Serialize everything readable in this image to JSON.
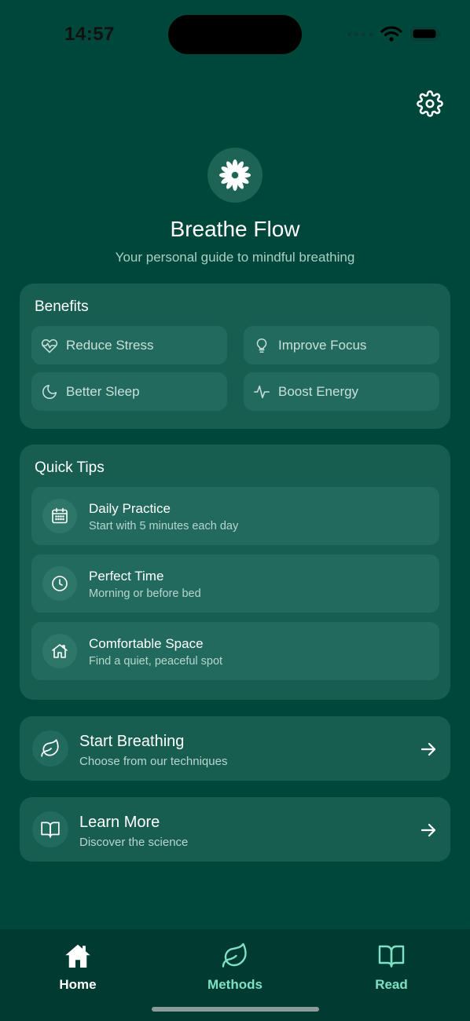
{
  "status_bar": {
    "time": "14:57"
  },
  "header": {
    "settings_icon": "gear-icon",
    "logo_icon": "sparkle-flower-icon",
    "title": "Breathe Flow",
    "subtitle": "Your personal guide to mindful breathing"
  },
  "benefits": {
    "title": "Benefits",
    "items": [
      {
        "label": "Reduce Stress",
        "icon": "heart-pulse-icon"
      },
      {
        "label": "Improve Focus",
        "icon": "lightbulb-icon"
      },
      {
        "label": "Better Sleep",
        "icon": "moon-icon"
      },
      {
        "label": "Boost Energy",
        "icon": "activity-icon"
      }
    ]
  },
  "tips": {
    "title": "Quick Tips",
    "items": [
      {
        "title": "Daily Practice",
        "subtitle": "Start with 5 minutes each day",
        "icon": "calendar-icon"
      },
      {
        "title": "Perfect Time",
        "subtitle": "Morning or before bed",
        "icon": "clock-icon"
      },
      {
        "title": "Comfortable Space",
        "subtitle": "Find a quiet, peaceful spot",
        "icon": "home-icon"
      }
    ]
  },
  "actions": [
    {
      "title": "Start Breathing",
      "subtitle": "Choose from our techniques",
      "icon": "leaf-icon"
    },
    {
      "title": "Learn More",
      "subtitle": "Discover the science",
      "icon": "book-icon"
    }
  ],
  "tabbar": {
    "tabs": [
      {
        "label": "Home",
        "icon": "home-icon",
        "selected": true
      },
      {
        "label": "Methods",
        "icon": "leaf-icon",
        "selected": false
      },
      {
        "label": "Read",
        "icon": "book-icon",
        "selected": false
      }
    ]
  },
  "colors": {
    "background": "#00473b",
    "card": "#175e51",
    "tab_active": "#ffffff",
    "tab_inactive": "#7fe0c4"
  }
}
